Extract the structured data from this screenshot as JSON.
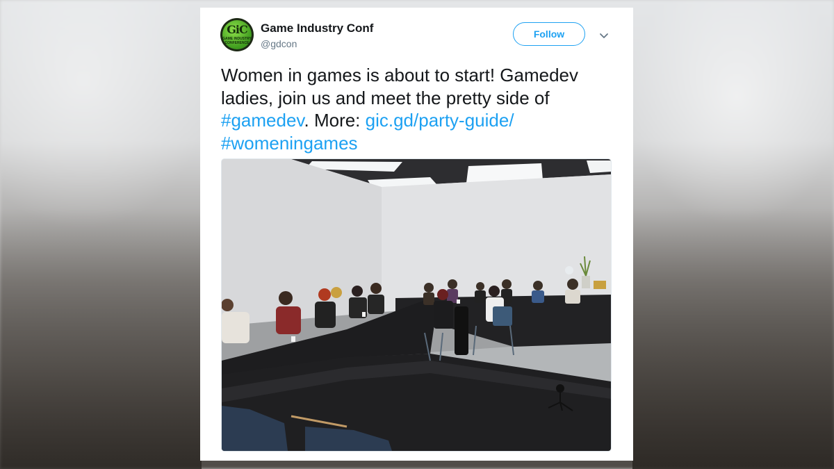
{
  "tweet": {
    "display_name": "Game Industry Conf",
    "handle": "@gdcon",
    "follow_label": "Follow",
    "avatar_logo": "GiC",
    "avatar_subtext": "GAME INDUSTRY CONFERENCE",
    "text_part1": "Women in games is about to start! Gamedev ladies, join us and meet the pretty side of ",
    "hashtag1": "#gamedev",
    "text_part2": ". More: ",
    "link": "gic.gd/party-guide/",
    "hashtag2": "#womeningames",
    "link_color": "#1da1f2",
    "photo_description_icon": "photo"
  },
  "icons": {
    "caret": "chevron-down-icon"
  }
}
